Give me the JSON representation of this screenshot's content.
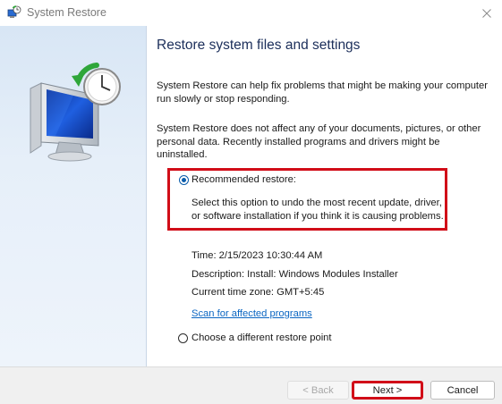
{
  "window": {
    "title": "System Restore",
    "icons": {
      "app": "system-restore-icon",
      "close": "close-icon"
    }
  },
  "sidebar": {
    "illustration": "system-restore-illustration"
  },
  "content": {
    "heading": "Restore system files and settings",
    "paragraph_1": "System Restore can help fix problems that might be making your computer run slowly or stop responding.",
    "paragraph_2": "System Restore does not affect any of your documents, pictures, or other personal data. Recently installed programs and drivers might be uninstalled.",
    "recommended": {
      "label": "Recommended restore:",
      "selected": true,
      "description": "Select this option to undo the most recent update, driver, or software installation if you think it is causing problems.",
      "time": "Time: 2/15/2023 10:30:44 AM",
      "description_line": "Description: Install: Windows Modules Installer",
      "timezone": "Current time zone: GMT+5:45",
      "scan_link": "Scan for affected programs"
    },
    "different": {
      "label": "Choose a different restore point",
      "selected": false
    }
  },
  "footer": {
    "back_label": "< Back",
    "next_label": "Next >",
    "cancel_label": "Cancel"
  },
  "colors": {
    "highlight": "#d10d18",
    "link": "#0b66c2",
    "heading": "#1b2e5a",
    "radio_checked": "#0b5cab"
  }
}
